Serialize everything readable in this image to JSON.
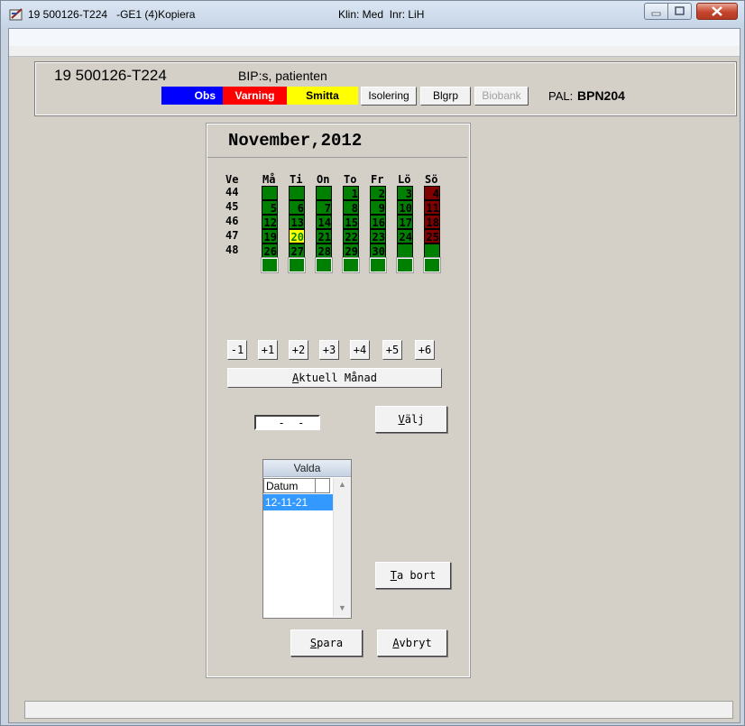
{
  "window": {
    "title_left": "19 500126-T224   -GE1 (4)Kopiera",
    "title_right": "Klin: Med  Inr: LiH",
    "controls": {
      "minimize": "minimize-icon",
      "maximize": "maximize-icon",
      "close": "close-icon"
    }
  },
  "patient": {
    "id": "19 500126-T224",
    "name": "BIP:s, patienten",
    "flags": {
      "obs": "Obs",
      "varning": "Varning",
      "smitta": "Smitta"
    },
    "buttons": {
      "isolering": "Isolering",
      "blgrp": "Blgrp",
      "biobank": "Biobank"
    },
    "pal_label": "PAL:",
    "pal_value": "BPN204"
  },
  "calendar": {
    "month_title": "November,2012",
    "week_header": "Ve",
    "day_headers": [
      "Må",
      "Ti",
      "On",
      "To",
      "Fr",
      "Lö",
      "Sö"
    ],
    "weeks": [
      "44",
      "45",
      "46",
      "47",
      "48"
    ],
    "rows": [
      [
        "",
        "",
        "",
        "1",
        "2",
        "3",
        "4"
      ],
      [
        "5",
        "6",
        "7",
        "8",
        "9",
        "10",
        "11"
      ],
      [
        "12",
        "13",
        "14",
        "15",
        "16",
        "17",
        "18"
      ],
      [
        "19",
        "20",
        "21",
        "22",
        "23",
        "24",
        "25"
      ],
      [
        "26",
        "27",
        "28",
        "29",
        "30",
        "",
        ""
      ],
      [
        "",
        "",
        "",
        "",
        "",
        "",
        ""
      ]
    ],
    "selected_day": "20",
    "offset_buttons": [
      "-1",
      "+1",
      "+2",
      "+3",
      "+4",
      "+5",
      "+6"
    ],
    "current_month_button": "Aktuell Månad",
    "date_input_value": "  -  -",
    "select_button": "Välj",
    "colors": {
      "weekday": "#008000",
      "weekend": "#800000",
      "selected": "#ffff00"
    }
  },
  "selected_list": {
    "title": "Valda",
    "column": "Datum",
    "items": [
      "12-11-21"
    ]
  },
  "actions": {
    "remove": "Ta bort",
    "save": "Spara",
    "cancel": "Avbryt"
  }
}
